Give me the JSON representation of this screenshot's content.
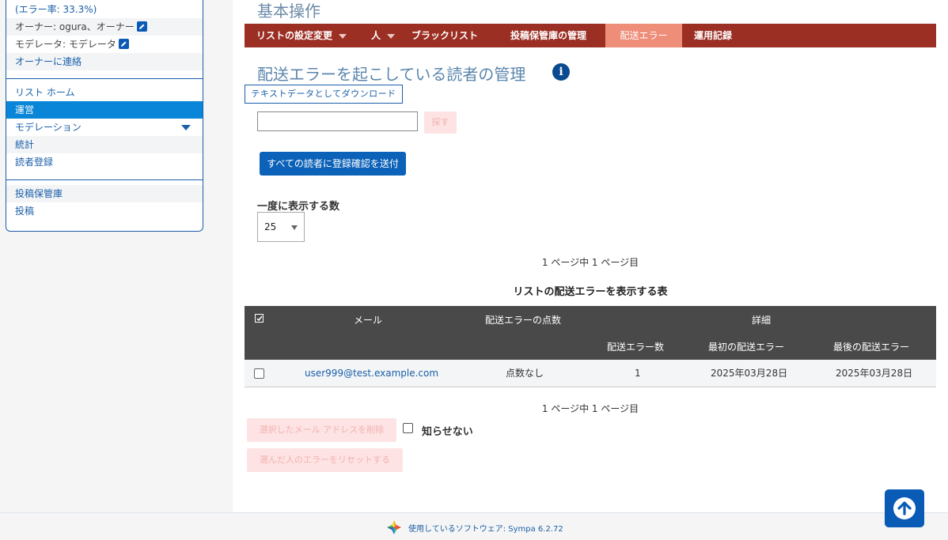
{
  "sidebar": {
    "error_rate": "(エラー率: 33.3%)",
    "owner": "オーナー: ogura、オーナー",
    "moderator": "モデレータ: モデレータ",
    "contact_owner": "オーナーに連絡",
    "list_home": "リスト ホーム",
    "admin": "運営",
    "moderation": "モデレーション",
    "stats": "統計",
    "subscribe": "読者登録",
    "archives": "投稿保管庫",
    "post": "投稿"
  },
  "main": {
    "title": "基本操作",
    "nav": {
      "list_settings": "リストの設定変更",
      "people": "人",
      "blacklist": "ブラックリスト",
      "archive_mgmt": "投稿保管庫の管理",
      "bounces": "配送エラー",
      "logs": "運用記録"
    },
    "page_heading": "配送エラーを起こしている読者の管理",
    "info_icon": "i",
    "download_button": "テキストデータとしてダウンロード",
    "search_input_value": "",
    "search_button": "探す",
    "confirm_button": "すべての読者に登録確認を送付",
    "per_page_label": "一度に表示する数",
    "per_page_value": "25",
    "pager_top": "1 ページ中 1 ページ目",
    "pager_bottom": "1 ページ中 1 ページ目",
    "table_caption": "リストの配送エラーを表示する表",
    "table": {
      "headers": {
        "email": "メール",
        "score": "配送エラーの点数",
        "details": "詳細",
        "count": "配送エラー数",
        "first": "最初の配送エラー",
        "last": "最後の配送エラー"
      },
      "rows": [
        {
          "email": "user999@test.example.com",
          "score": "点数なし",
          "count": "1",
          "first": "2025年03月28日",
          "last": "2025年03月28日"
        }
      ]
    },
    "delete_button": "選択したメール アドレスを削除",
    "quiet_label": "知らせない",
    "reset_button": "選んだ人のエラーをリセットする"
  },
  "footer": {
    "text": "使用しているソフトウェア: Sympa 6.2.72"
  },
  "colors": {
    "nav_bg": "#9c2f24",
    "nav_active": "#ee8d78",
    "link": "#1a5fa8",
    "primary_button": "#0b62b8",
    "table_header": "#494949"
  }
}
